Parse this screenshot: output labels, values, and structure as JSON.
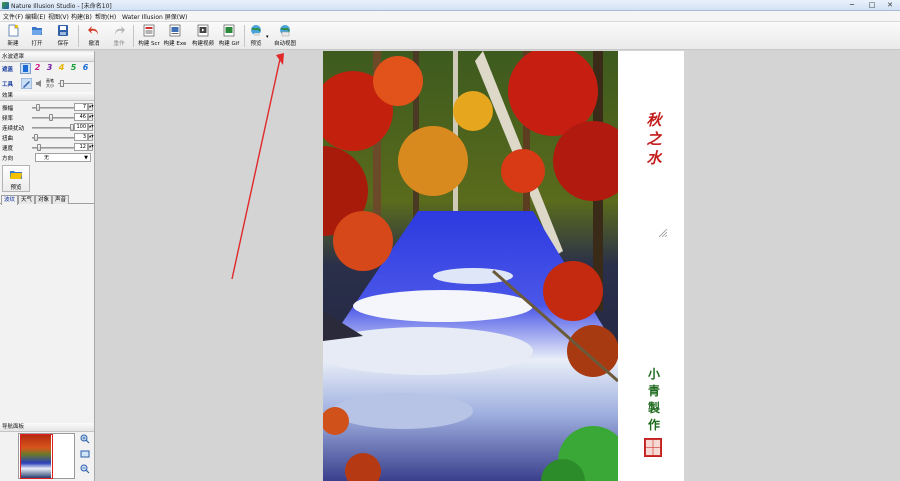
{
  "window": {
    "title": "Nature Illusion Studio - [未命名10]",
    "min": "─",
    "max": "□",
    "close": "✕"
  },
  "menu": [
    "文件(F)",
    "编辑(E)",
    "视图(V)",
    "构建(B)",
    "帮助(H)",
    "Water Illusion 屏保(W)"
  ],
  "toolbar": {
    "new": "新建",
    "open": "打开",
    "save": "保存",
    "undo": "撤消",
    "redo": "重作",
    "build_scr": "构建 Scr",
    "build_exe": "构建 Exe",
    "build_video": "构建视频",
    "build_gif": "构建 Gif",
    "preview": "预览",
    "auto_view": "自动视图"
  },
  "left_panel": {
    "water_header": "水波遮罩",
    "row_mask": "遮盖",
    "row_tool": "工具",
    "brush_numbers": [
      "2",
      "3",
      "4",
      "5",
      "6"
    ],
    "brush_colors": [
      "#d01c8b",
      "#7a1fa2",
      "#e8b400",
      "#1a9e3a",
      "#1a6bd6"
    ],
    "brush_size_label": "画笔\n大小",
    "effects_header": "效果",
    "sliders": [
      {
        "label": "振幅",
        "value": "7",
        "fraction": 0.1
      },
      {
        "label": "频率",
        "value": "46",
        "fraction": 0.46
      },
      {
        "label": "连续扰动",
        "value": "100",
        "fraction": 1.0
      },
      {
        "label": "扭曲",
        "value": "3",
        "fraction": 0.05
      },
      {
        "label": "速度",
        "value": "12",
        "fraction": 0.12
      }
    ],
    "direction_label": "方向",
    "direction_value": "无",
    "preview_button": "预览",
    "tabs": [
      "波纹",
      "天气",
      "对象",
      "声音"
    ],
    "nav_header": "导航面板"
  },
  "canvas": {
    "poem": [
      "秋",
      "之",
      "水"
    ],
    "author": [
      "小",
      "青",
      "製",
      "作"
    ],
    "seal": [
      "小",
      "青",
      "印",
      "鑑"
    ]
  }
}
